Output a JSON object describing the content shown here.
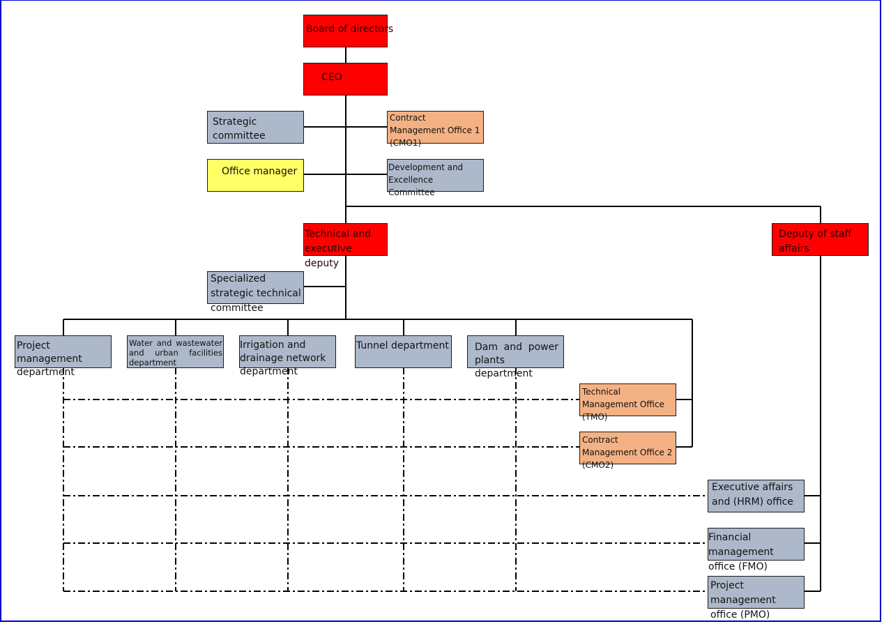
{
  "chart_title": "",
  "nodes": {
    "board": "Board of directors",
    "ceo": "CEO",
    "strategic_committee": "Strategic committee",
    "cmo1": "Contract Management Office 1 (CMO1)",
    "office_manager": "Office manager",
    "dev_excellence": "Development and Excellence Committee",
    "tech_exec_deputy": "Technical and executive deputy",
    "deputy_staff": "Deputy of staff affairs",
    "specialized_committee": "Specialized strategic technical committee",
    "project_mgmt_dept": "Project management department",
    "water_dept": "Water and wastewater and urban facilities department",
    "irrigation_dept": "Irrigation and drainage network department",
    "tunnel_dept": "Tunnel department",
    "dam_dept": "Dam and power plants department",
    "tmo": "Technical Management Office (TMO)",
    "cmo2": "Contract Management Office 2 (CMO2)",
    "hrm_office": "Executive affairs and (HRM) office",
    "fmo": "Financial management office (FMO)",
    "pmo": "Project management office (PMO)"
  },
  "colors": {
    "executive": "#ff0000",
    "committee": "#adb9ca",
    "office": "#f4b183",
    "office_manager": "#ffff66",
    "frame": "#0000c8"
  }
}
